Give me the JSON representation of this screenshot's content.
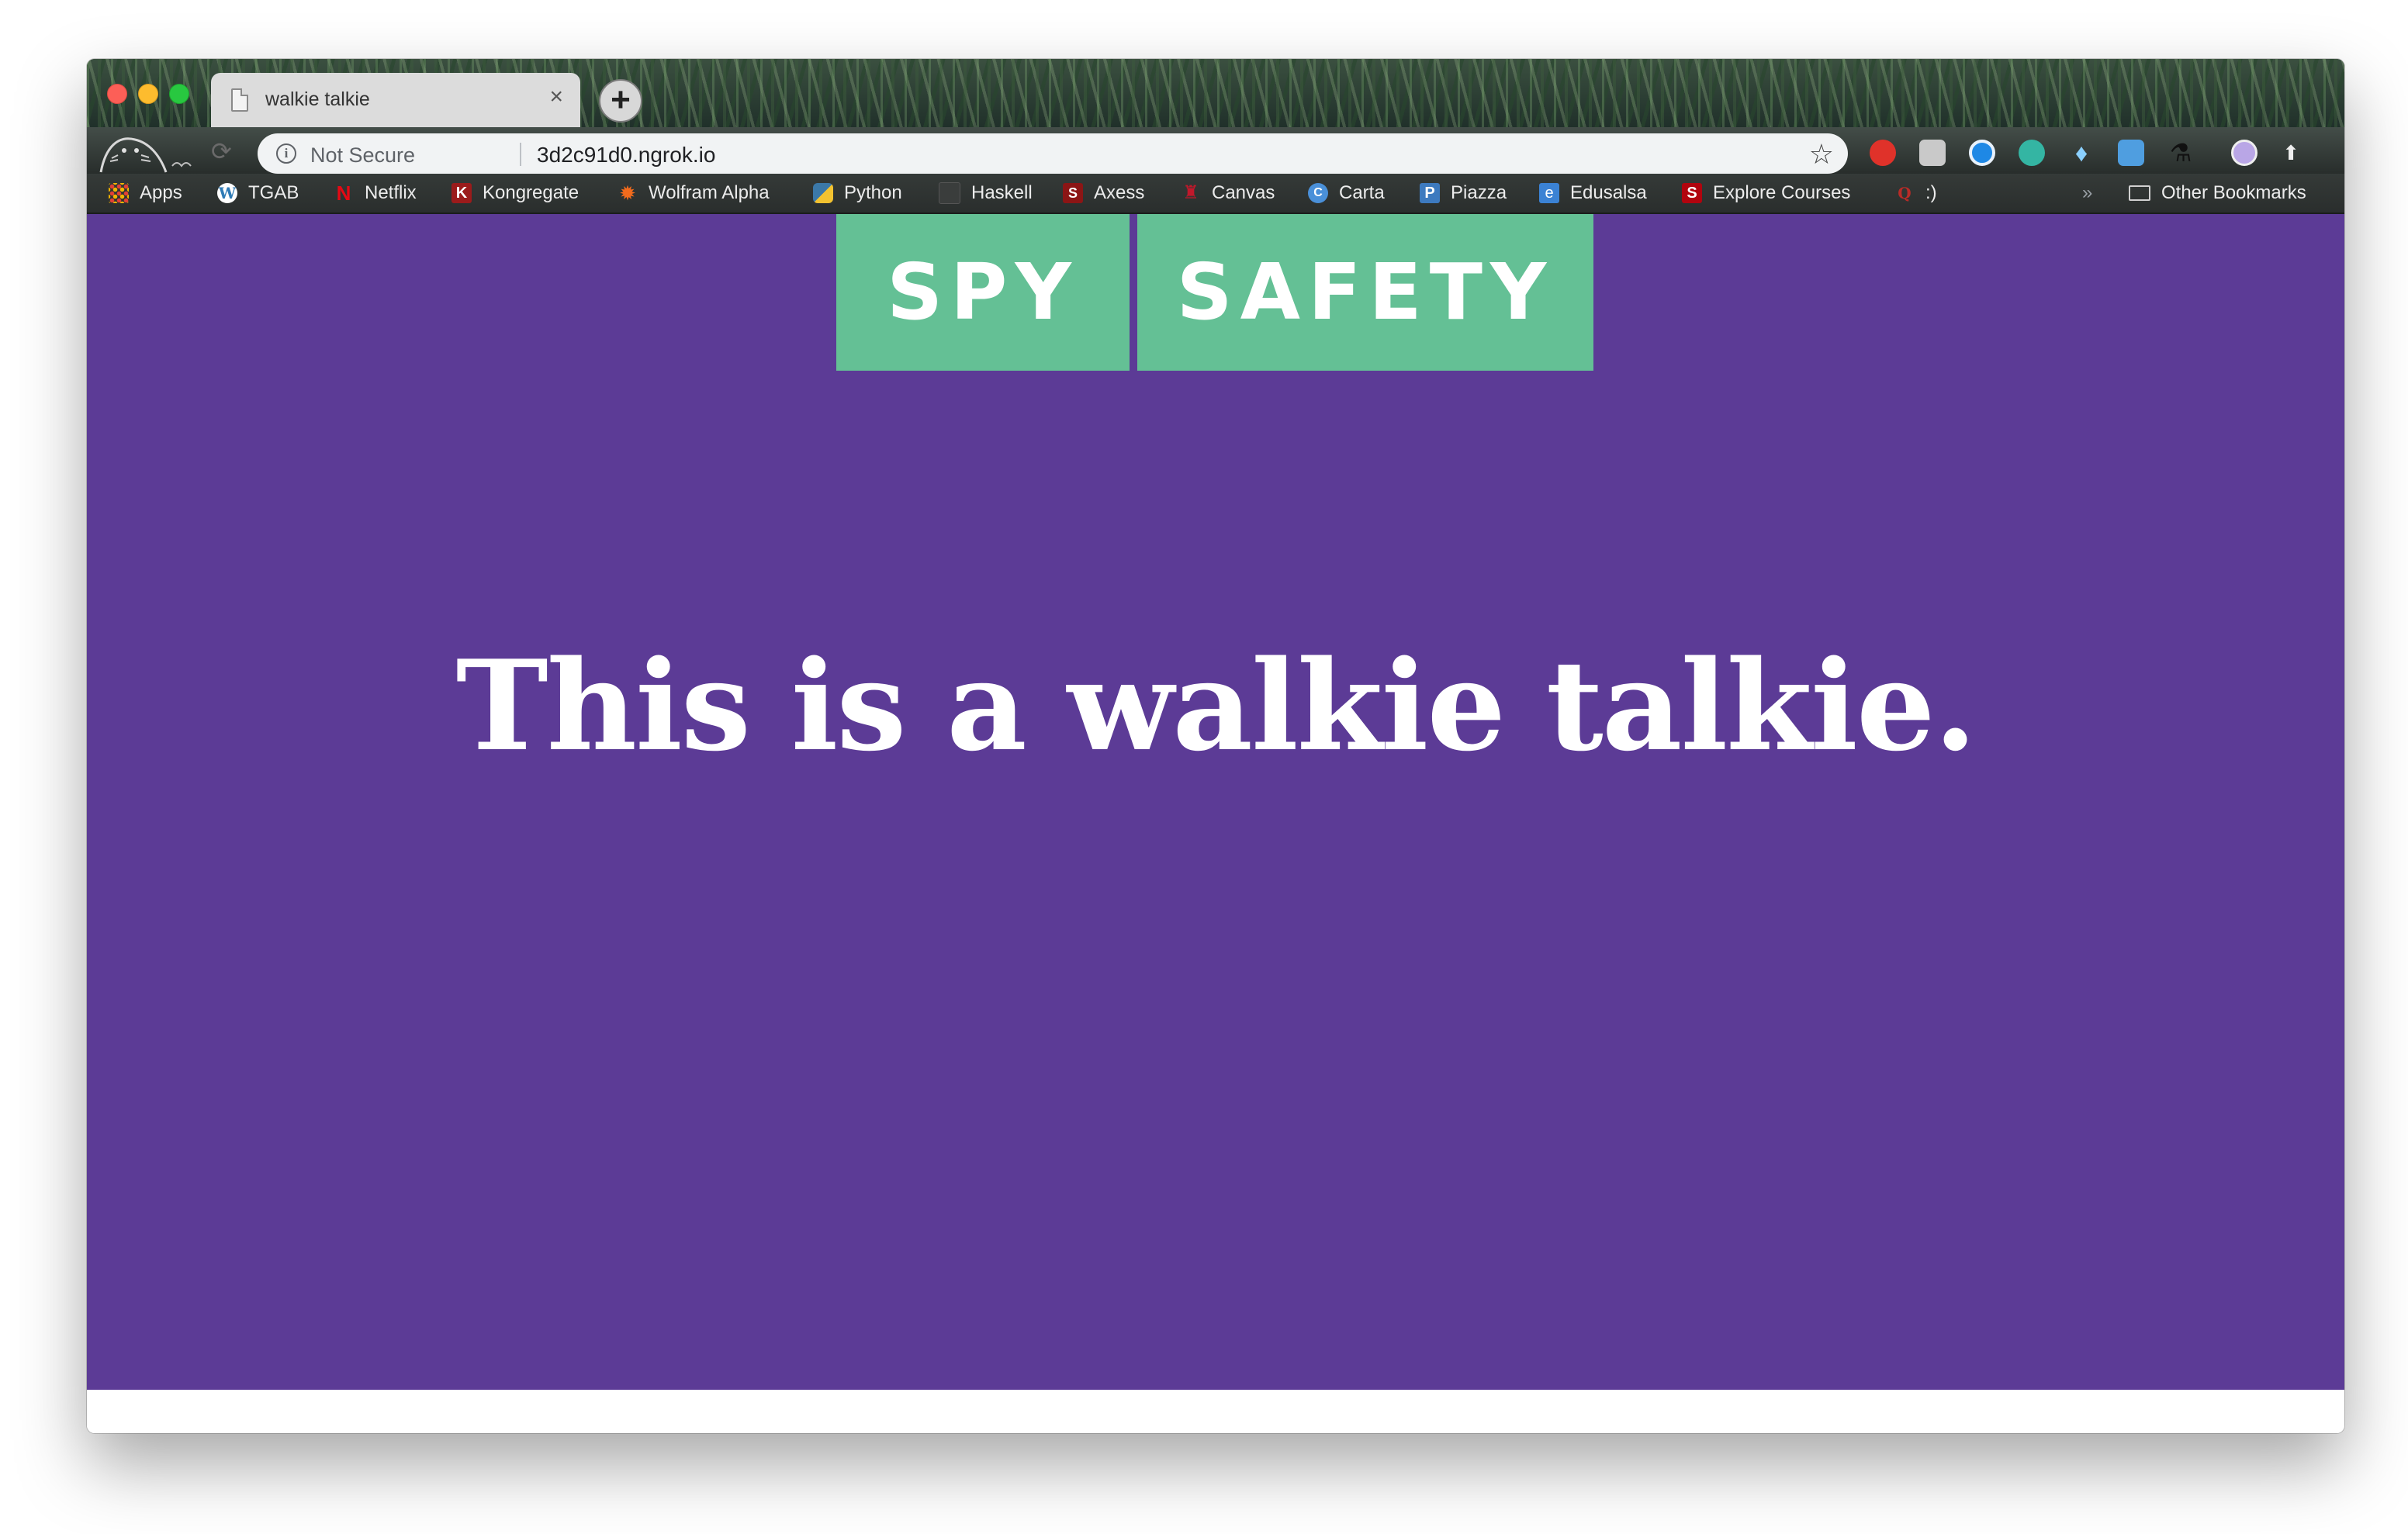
{
  "browser": {
    "tab": {
      "title": "walkie talkie",
      "close_glyph": "×"
    },
    "new_tab_glyph": "+",
    "omnibox": {
      "security_label": "Not Secure",
      "url": "3d2c91d0.ngrok.io"
    },
    "bookmarks": [
      {
        "label": "Apps",
        "icon": "apps-grid-icon",
        "color": "#e34133"
      },
      {
        "label": "TGAB",
        "icon": "wordpress-icon",
        "color": "#2f7bb6"
      },
      {
        "label": "Netflix",
        "icon": "netflix-icon",
        "color": "#e50914"
      },
      {
        "label": "Kongregate",
        "icon": "kongregate-icon",
        "color": "#9b1b1b"
      },
      {
        "label": "Wolfram Alpha",
        "icon": "wolfram-icon",
        "color": "#f26b1d"
      },
      {
        "label": "Python",
        "icon": "python-icon",
        "color": "#3b78a8"
      },
      {
        "label": "Haskell",
        "icon": "page-icon",
        "color": "#4a4a4a"
      },
      {
        "label": "Axess",
        "icon": "axess-icon",
        "color": "#8c1515"
      },
      {
        "label": "Canvas",
        "icon": "canvas-icon",
        "color": "#8c1515"
      },
      {
        "label": "Carta",
        "icon": "carta-icon",
        "color": "#4a90d9"
      },
      {
        "label": "Piazza",
        "icon": "piazza-icon",
        "color": "#3d7abf"
      },
      {
        "label": "Edusalsa",
        "icon": "edusalsa-icon",
        "color": "#3b82d4"
      },
      {
        "label": "Explore Courses",
        "icon": "stanford-icon",
        "color": "#b1040e"
      },
      {
        "label": ":)",
        "icon": "quora-icon",
        "color": "#b92b27"
      }
    ],
    "overflow_glyph": "»",
    "other_bookmarks": "Other Bookmarks"
  },
  "page": {
    "buttons": {
      "spy": "SPY",
      "safety": "SAFETY"
    },
    "headline": "This is a walkie talkie.",
    "colors": {
      "background": "#5c3b96",
      "button": "#64c095",
      "text": "#ffffff"
    }
  }
}
